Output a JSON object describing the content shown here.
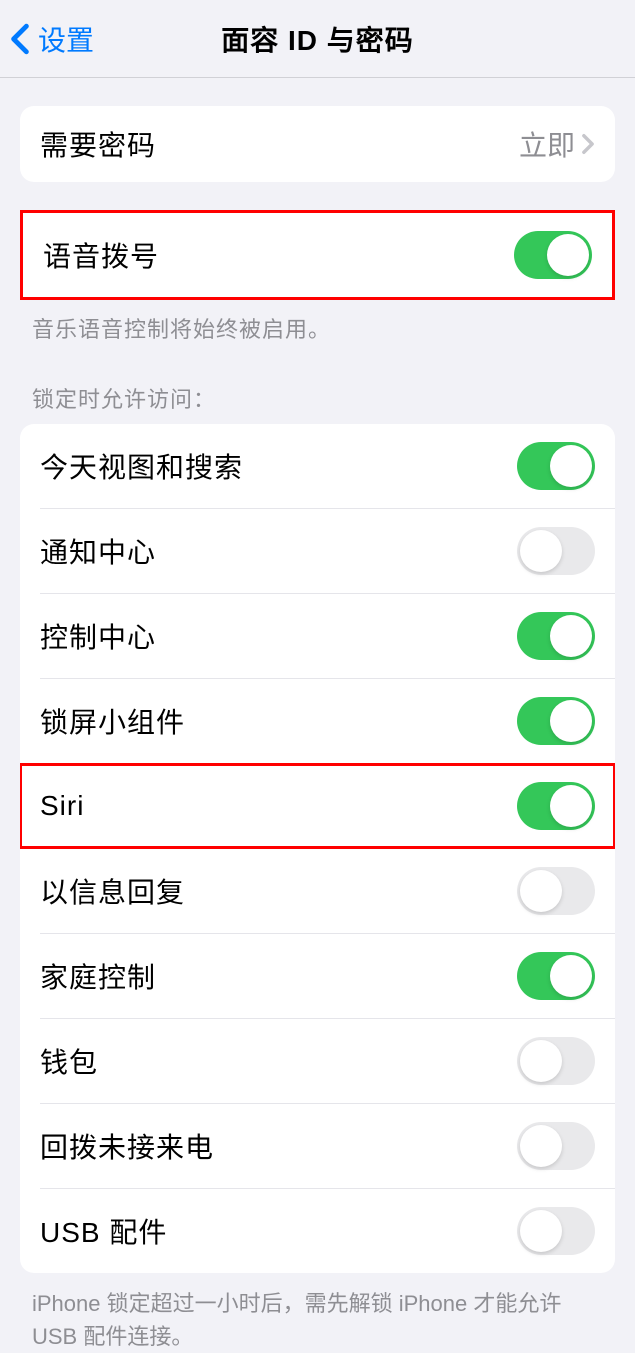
{
  "header": {
    "back_label": "设置",
    "title": "面容 ID 与密码"
  },
  "require_passcode": {
    "label": "需要密码",
    "value": "立即"
  },
  "voice_dial": {
    "label": "语音拨号",
    "enabled": true,
    "footer": "音乐语音控制将始终被启用。"
  },
  "lock_access": {
    "header": "锁定时允许访问：",
    "items": [
      {
        "label": "今天视图和搜索",
        "enabled": true
      },
      {
        "label": "通知中心",
        "enabled": false
      },
      {
        "label": "控制中心",
        "enabled": true
      },
      {
        "label": "锁屏小组件",
        "enabled": true
      },
      {
        "label": "Siri",
        "enabled": true
      },
      {
        "label": "以信息回复",
        "enabled": false
      },
      {
        "label": "家庭控制",
        "enabled": true
      },
      {
        "label": "钱包",
        "enabled": false
      },
      {
        "label": "回拨未接来电",
        "enabled": false
      },
      {
        "label": "USB 配件",
        "enabled": false
      }
    ],
    "footer": "iPhone 锁定超过一小时后，需先解锁 iPhone 才能允许 USB 配件连接。"
  },
  "highlighted_rows": [
    0,
    4
  ]
}
